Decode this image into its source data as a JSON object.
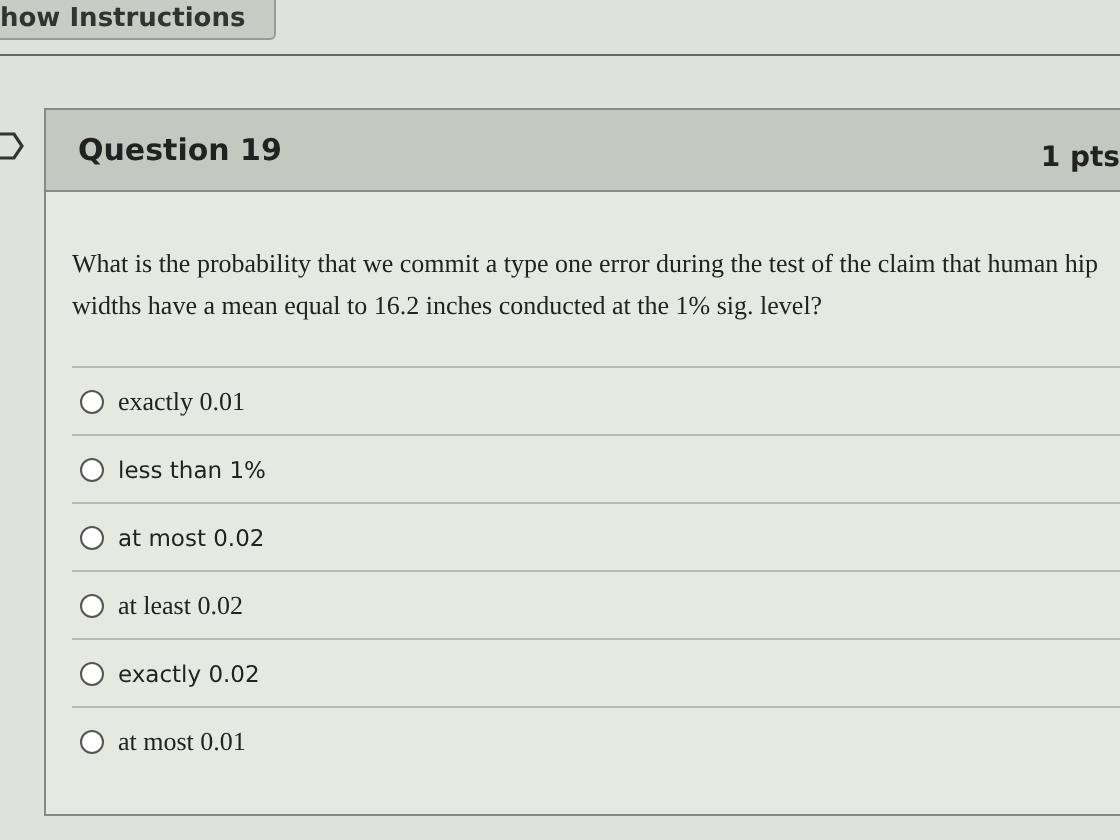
{
  "instructions_button": {
    "label": "how Instructions"
  },
  "question": {
    "title": "Question 19",
    "points": "1 pts",
    "text": "What is the probability that we commit a type one error during the test of the claim that human hip widths have a mean equal to 16.2 inches conducted at the 1% sig. level?",
    "answers": [
      {
        "label": "exactly 0.01",
        "kind": "serif",
        "selected": false
      },
      {
        "label": "less than 1%",
        "kind": "sans",
        "selected": false
      },
      {
        "label": "at most 0.02",
        "kind": "sans",
        "selected": false
      },
      {
        "label": "at least 0.02",
        "kind": "serif",
        "selected": false
      },
      {
        "label": "exactly 0.02",
        "kind": "sans",
        "selected": false
      },
      {
        "label": "at most 0.01",
        "kind": "serif",
        "selected": false
      }
    ]
  }
}
